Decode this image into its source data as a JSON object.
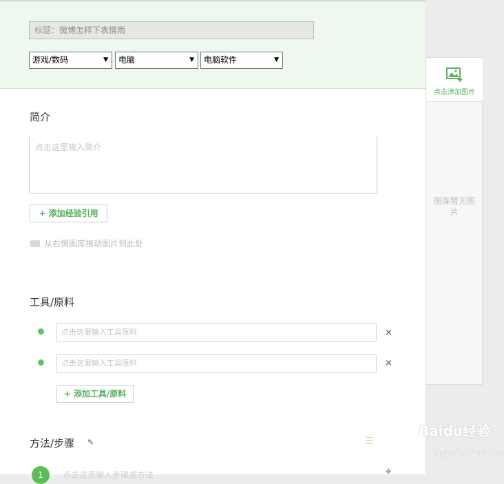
{
  "header": {
    "title_label": "标题：",
    "title_value": "微博怎样下表情雨",
    "categories": [
      "游戏/数码",
      "电脑",
      "电脑软件"
    ]
  },
  "intro": {
    "heading": "简介",
    "placeholder": "点击这里输入简介",
    "add_reference_button": "+ 添加经验引用",
    "drag_hint": "从右侧图库拖动图片到此处"
  },
  "tools": {
    "heading": "工具/原料",
    "items": [
      {
        "placeholder": "点击这里输入工具原料"
      },
      {
        "placeholder": "点击这里输入工具原料"
      }
    ],
    "remove_symbol": "×",
    "add_button": "+ 添加工具/原料"
  },
  "steps": {
    "heading": "方法/步骤",
    "first_step_number": "1",
    "first_step_placeholder": "点击这里输入步骤或方法"
  },
  "sidebar": {
    "add_image_label": "点击添加图片",
    "empty_text": "图库暂无图片"
  },
  "watermark": {
    "brand": "Baidu经验",
    "url": "jingyan.baidu.com"
  },
  "colors": {
    "accent_green": "#5ebc58",
    "header_bg": "#eef8ee"
  }
}
